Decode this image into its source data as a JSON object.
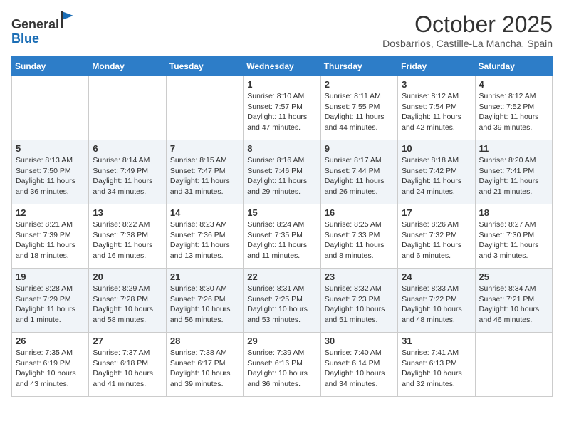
{
  "header": {
    "logo_line1": "General",
    "logo_line2": "Blue",
    "month": "October 2025",
    "location": "Dosbarrios, Castille-La Mancha, Spain"
  },
  "weekdays": [
    "Sunday",
    "Monday",
    "Tuesday",
    "Wednesday",
    "Thursday",
    "Friday",
    "Saturday"
  ],
  "weeks": [
    [
      {
        "day": "",
        "info": ""
      },
      {
        "day": "",
        "info": ""
      },
      {
        "day": "",
        "info": ""
      },
      {
        "day": "1",
        "info": "Sunrise: 8:10 AM\nSunset: 7:57 PM\nDaylight: 11 hours and 47 minutes."
      },
      {
        "day": "2",
        "info": "Sunrise: 8:11 AM\nSunset: 7:55 PM\nDaylight: 11 hours and 44 minutes."
      },
      {
        "day": "3",
        "info": "Sunrise: 8:12 AM\nSunset: 7:54 PM\nDaylight: 11 hours and 42 minutes."
      },
      {
        "day": "4",
        "info": "Sunrise: 8:12 AM\nSunset: 7:52 PM\nDaylight: 11 hours and 39 minutes."
      }
    ],
    [
      {
        "day": "5",
        "info": "Sunrise: 8:13 AM\nSunset: 7:50 PM\nDaylight: 11 hours and 36 minutes."
      },
      {
        "day": "6",
        "info": "Sunrise: 8:14 AM\nSunset: 7:49 PM\nDaylight: 11 hours and 34 minutes."
      },
      {
        "day": "7",
        "info": "Sunrise: 8:15 AM\nSunset: 7:47 PM\nDaylight: 11 hours and 31 minutes."
      },
      {
        "day": "8",
        "info": "Sunrise: 8:16 AM\nSunset: 7:46 PM\nDaylight: 11 hours and 29 minutes."
      },
      {
        "day": "9",
        "info": "Sunrise: 8:17 AM\nSunset: 7:44 PM\nDaylight: 11 hours and 26 minutes."
      },
      {
        "day": "10",
        "info": "Sunrise: 8:18 AM\nSunset: 7:42 PM\nDaylight: 11 hours and 24 minutes."
      },
      {
        "day": "11",
        "info": "Sunrise: 8:20 AM\nSunset: 7:41 PM\nDaylight: 11 hours and 21 minutes."
      }
    ],
    [
      {
        "day": "12",
        "info": "Sunrise: 8:21 AM\nSunset: 7:39 PM\nDaylight: 11 hours and 18 minutes."
      },
      {
        "day": "13",
        "info": "Sunrise: 8:22 AM\nSunset: 7:38 PM\nDaylight: 11 hours and 16 minutes."
      },
      {
        "day": "14",
        "info": "Sunrise: 8:23 AM\nSunset: 7:36 PM\nDaylight: 11 hours and 13 minutes."
      },
      {
        "day": "15",
        "info": "Sunrise: 8:24 AM\nSunset: 7:35 PM\nDaylight: 11 hours and 11 minutes."
      },
      {
        "day": "16",
        "info": "Sunrise: 8:25 AM\nSunset: 7:33 PM\nDaylight: 11 hours and 8 minutes."
      },
      {
        "day": "17",
        "info": "Sunrise: 8:26 AM\nSunset: 7:32 PM\nDaylight: 11 hours and 6 minutes."
      },
      {
        "day": "18",
        "info": "Sunrise: 8:27 AM\nSunset: 7:30 PM\nDaylight: 11 hours and 3 minutes."
      }
    ],
    [
      {
        "day": "19",
        "info": "Sunrise: 8:28 AM\nSunset: 7:29 PM\nDaylight: 11 hours and 1 minute."
      },
      {
        "day": "20",
        "info": "Sunrise: 8:29 AM\nSunset: 7:28 PM\nDaylight: 10 hours and 58 minutes."
      },
      {
        "day": "21",
        "info": "Sunrise: 8:30 AM\nSunset: 7:26 PM\nDaylight: 10 hours and 56 minutes."
      },
      {
        "day": "22",
        "info": "Sunrise: 8:31 AM\nSunset: 7:25 PM\nDaylight: 10 hours and 53 minutes."
      },
      {
        "day": "23",
        "info": "Sunrise: 8:32 AM\nSunset: 7:23 PM\nDaylight: 10 hours and 51 minutes."
      },
      {
        "day": "24",
        "info": "Sunrise: 8:33 AM\nSunset: 7:22 PM\nDaylight: 10 hours and 48 minutes."
      },
      {
        "day": "25",
        "info": "Sunrise: 8:34 AM\nSunset: 7:21 PM\nDaylight: 10 hours and 46 minutes."
      }
    ],
    [
      {
        "day": "26",
        "info": "Sunrise: 7:35 AM\nSunset: 6:19 PM\nDaylight: 10 hours and 43 minutes."
      },
      {
        "day": "27",
        "info": "Sunrise: 7:37 AM\nSunset: 6:18 PM\nDaylight: 10 hours and 41 minutes."
      },
      {
        "day": "28",
        "info": "Sunrise: 7:38 AM\nSunset: 6:17 PM\nDaylight: 10 hours and 39 minutes."
      },
      {
        "day": "29",
        "info": "Sunrise: 7:39 AM\nSunset: 6:16 PM\nDaylight: 10 hours and 36 minutes."
      },
      {
        "day": "30",
        "info": "Sunrise: 7:40 AM\nSunset: 6:14 PM\nDaylight: 10 hours and 34 minutes."
      },
      {
        "day": "31",
        "info": "Sunrise: 7:41 AM\nSunset: 6:13 PM\nDaylight: 10 hours and 32 minutes."
      },
      {
        "day": "",
        "info": ""
      }
    ]
  ]
}
